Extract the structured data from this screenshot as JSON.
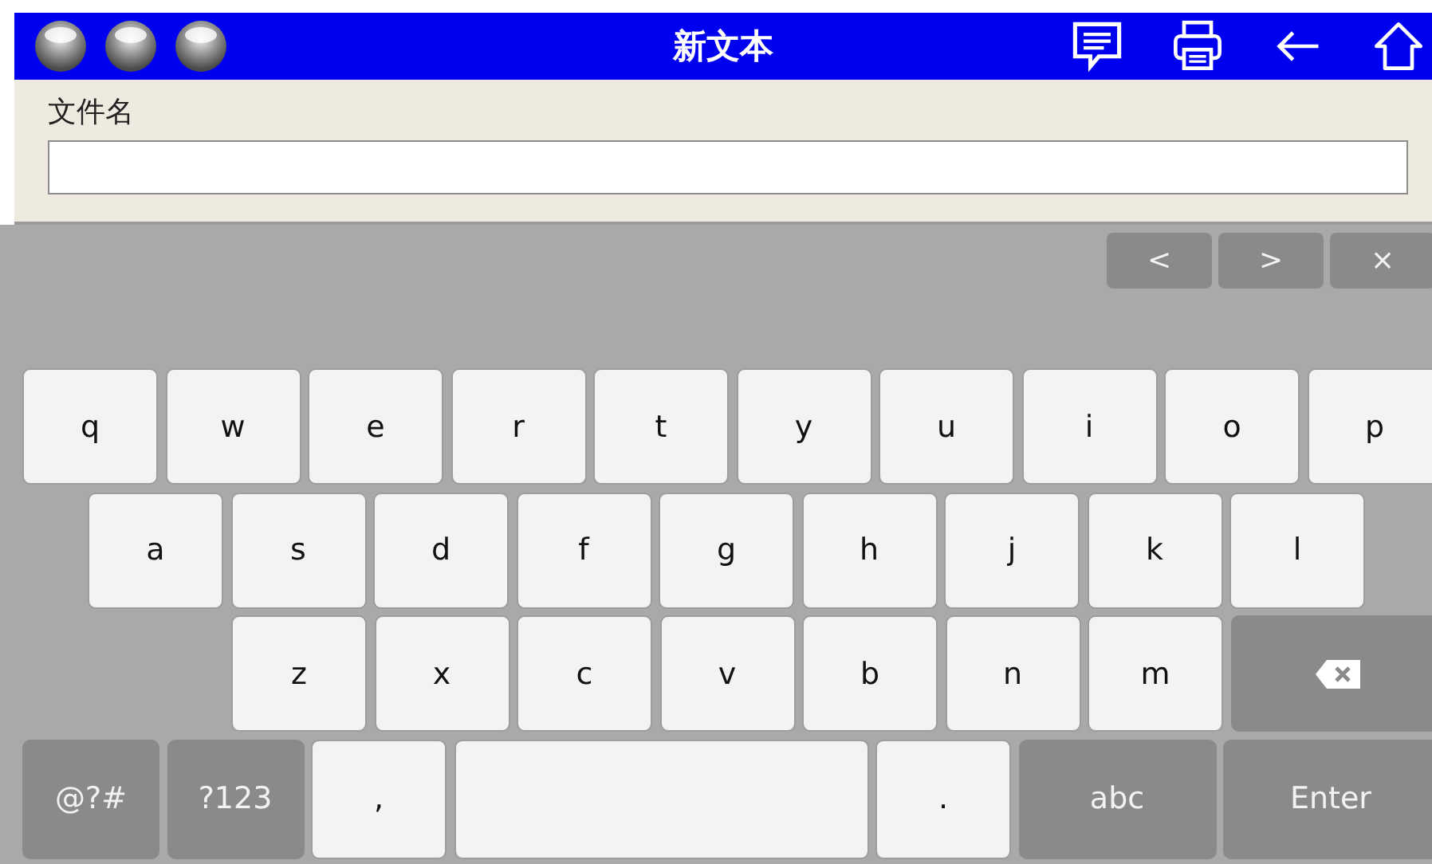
{
  "window": {
    "title": "新文本"
  },
  "form": {
    "label": "文件名"
  },
  "keyboard": {
    "nav": [
      {
        "label": "<"
      },
      {
        "label": ">"
      },
      {
        "label": "×"
      }
    ],
    "rows": [
      [
        {
          "kind": "char",
          "label": "q"
        },
        {
          "kind": "char",
          "label": "w"
        },
        {
          "kind": "char",
          "label": "e"
        },
        {
          "kind": "char",
          "label": "r"
        },
        {
          "kind": "char",
          "label": "t"
        },
        {
          "kind": "char",
          "label": "y"
        },
        {
          "kind": "char",
          "label": "u"
        },
        {
          "kind": "char",
          "label": "i"
        },
        {
          "kind": "char",
          "label": "o"
        },
        {
          "kind": "char",
          "label": "p"
        }
      ],
      [
        {
          "kind": "char",
          "label": "a"
        },
        {
          "kind": "char",
          "label": "s"
        },
        {
          "kind": "char",
          "label": "d"
        },
        {
          "kind": "char",
          "label": "f"
        },
        {
          "kind": "char",
          "label": "g"
        },
        {
          "kind": "char",
          "label": "h"
        },
        {
          "kind": "char",
          "label": "j"
        },
        {
          "kind": "char",
          "label": "k"
        },
        {
          "kind": "char",
          "label": "l"
        }
      ],
      [
        {
          "kind": "char",
          "label": "z"
        },
        {
          "kind": "char",
          "label": "x"
        },
        {
          "kind": "char",
          "label": "c"
        },
        {
          "kind": "char",
          "label": "v"
        },
        {
          "kind": "char",
          "label": "b"
        },
        {
          "kind": "char",
          "label": "n"
        },
        {
          "kind": "char",
          "label": "m"
        },
        {
          "kind": "backspace"
        }
      ],
      [
        {
          "kind": "mod",
          "label": "@?#"
        },
        {
          "kind": "mod",
          "label": "?123"
        },
        {
          "kind": "char",
          "label": ","
        },
        {
          "kind": "space"
        },
        {
          "kind": "char",
          "label": "."
        },
        {
          "kind": "mod-wide",
          "label": "abc"
        },
        {
          "kind": "mod-end",
          "label": "Enter"
        }
      ]
    ]
  }
}
